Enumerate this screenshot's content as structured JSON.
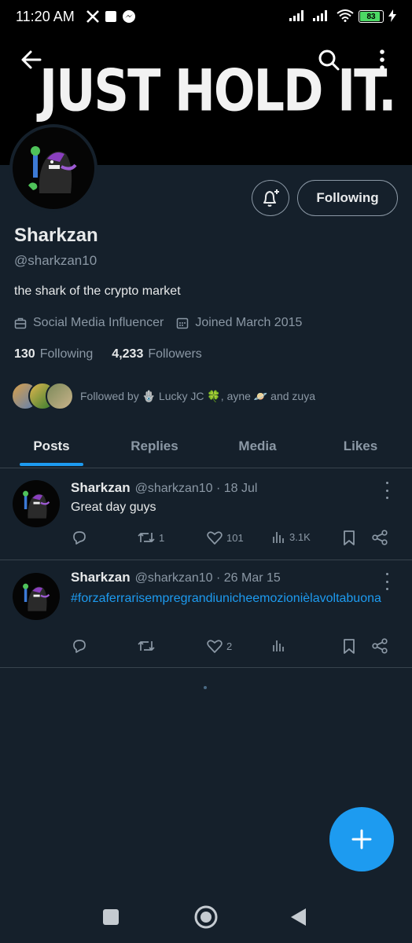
{
  "status_bar": {
    "time": "11:20 AM",
    "battery": "83",
    "icons": [
      "x-logo-icon",
      "notification-square-icon",
      "messenger-icon",
      "signal-icon",
      "signal-icon",
      "wifi-icon",
      "battery-icon",
      "charging-icon"
    ]
  },
  "banner": {
    "text": "JUST HOLD IT."
  },
  "profile": {
    "name": "Sharkzan",
    "handle": "@sharkzan10",
    "bio": "the shark of the crypto market",
    "category": "Social Media Influencer",
    "joined": "Joined March 2015",
    "following_count": "130",
    "following_label": "Following",
    "followers_count": "4,233",
    "followers_label": "Followers",
    "followed_by": "Followed by 🪬 Lucky JC 🍀, ayne 🪐 and zuya",
    "follow_button": "Following"
  },
  "tabs": [
    "Posts",
    "Replies",
    "Media",
    "Likes"
  ],
  "active_tab": "Posts",
  "posts": [
    {
      "name": "Sharkzan",
      "meta": "@sharkzan10 · 18 Jul",
      "text": "Great day guys",
      "retweets": "1",
      "likes": "101",
      "views": "3.1K"
    },
    {
      "name": "Sharkzan",
      "meta": "@sharkzan10 · 26 Mar 15",
      "text": "#forzaferrarisempregrandiunicheemozionièlavoltabuona",
      "retweets": "",
      "likes": "2",
      "views": ""
    }
  ],
  "colors": {
    "background": "#15202b",
    "accent": "#1d9bf0",
    "text_primary": "#e7e9ea",
    "text_secondary": "#8b98a5",
    "divider": "#38444d"
  }
}
